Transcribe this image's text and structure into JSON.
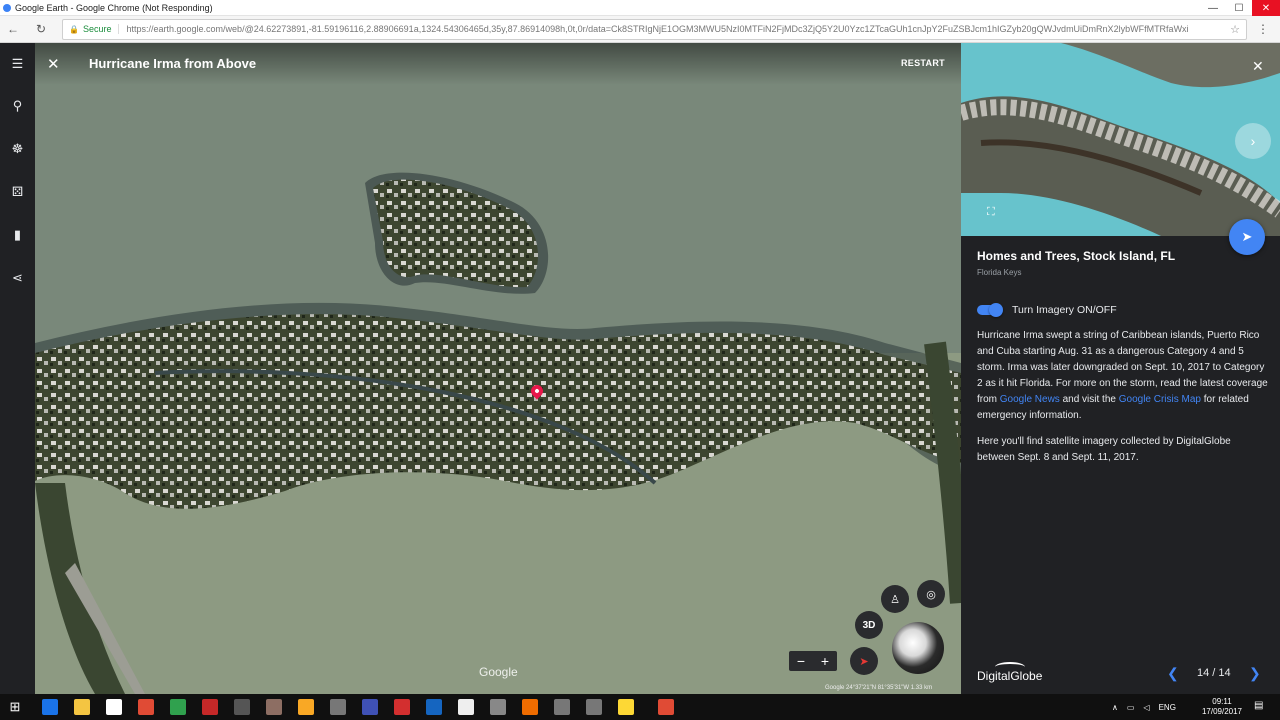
{
  "browser": {
    "window_title": "Google Earth - Google Chrome (Not Responding)",
    "secure_label": "Secure",
    "url": "https://earth.google.com/web/@24.62273891,-81.59196116,2.88906691a,1324.54306465d,35y,87.86914098h,0t,0r/data=Ck8STRIgNjE1OGM3MWU5NzI0MTFiN2FjMDc3ZjQ5Y2U0Yzc1ZTcaGUh1cnJpY2FuZSBJcm1hIGZyb20gQWJvdmUiDmRnX2lybWFfMTRfaWxi"
  },
  "rail": {
    "items": [
      "menu-icon",
      "search-icon",
      "voyager-icon",
      "feeling-lucky-icon",
      "bookmark-icon",
      "share-icon"
    ]
  },
  "tour": {
    "title": "Hurricane Irma from Above",
    "restart_label": "RESTART"
  },
  "map": {
    "google_logo": "Google",
    "attribution": "Google   24°37'21\"N 81°35'31\"W   1.33 km",
    "control_3d": "3D",
    "zoom_out": "−",
    "zoom_in": "+"
  },
  "panel": {
    "place_title": "Homes and Trees, Stock Island, FL",
    "place_subtitle": "Florida Keys",
    "toggle_label": "Turn Imagery ON/OFF",
    "toggle_on": true,
    "desc1_before": "Hurricane Irma swept a string of Caribbean islands, Puerto Rico and Cuba starting Aug. 31 as a dangerous Category 4 and 5 storm. Irma was later downgraded on Sept. 10, 2017 to Category 2 as it hit Florida. For more on the storm, read the latest coverage from ",
    "link_news": "Google News",
    "desc1_mid": " and visit the ",
    "link_crisis": "Google Crisis Map",
    "desc1_after": " for related emergency information.",
    "desc2": "Here you'll find satellite imagery collected by DigitalGlobe between Sept. 8 and Sept. 11, 2017.",
    "provider": "DigitalGlobe",
    "pager": "14 / 14"
  },
  "taskbar": {
    "lang": "ENG",
    "time": "09:11",
    "date": "17/09/2017"
  },
  "colors": {
    "accent": "#4285f4",
    "panel_bg": "#202124",
    "pin": "#e8174a"
  }
}
